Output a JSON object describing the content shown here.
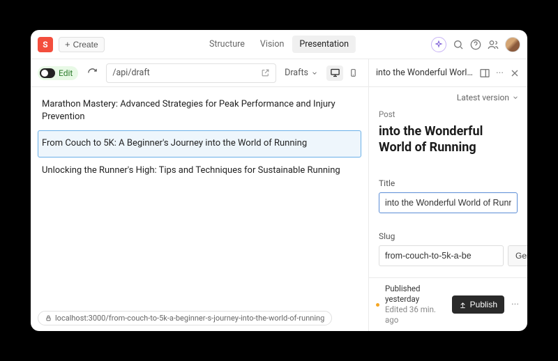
{
  "logo_letter": "S",
  "create_label": "Create",
  "nav": {
    "structure": "Structure",
    "vision": "Vision",
    "presentation": "Presentation"
  },
  "toolbar": {
    "edit_label": "Edit",
    "url": "/api/draft",
    "drafts_label": "Drafts"
  },
  "posts": [
    "Marathon Mastery: Advanced Strategies for Peak Performance and Injury Prevention",
    "From Couch to 5K: A Beginner's Journey into the World of Running",
    "Unlocking the Runner's High: Tips and Techniques for Sustainable Running"
  ],
  "status_url": "localhost:3000/from-couch-to-5k-a-beginner-s-journey-into-the-world-of-running",
  "panel": {
    "title": "into the Wonderful World of R...",
    "version": "Latest version",
    "type_label": "Post",
    "doc_title": "into the Wonderful World of Running",
    "title_label": "Title",
    "title_value": "into the Wonderful World of Runnir",
    "slug_label": "Slug",
    "slug_value": "from-couch-to-5k-a-be",
    "generate_label": "Generate",
    "published_line": "Published yesterday",
    "edited_line": "Edited 36 min. ago",
    "publish_label": "Publish"
  }
}
